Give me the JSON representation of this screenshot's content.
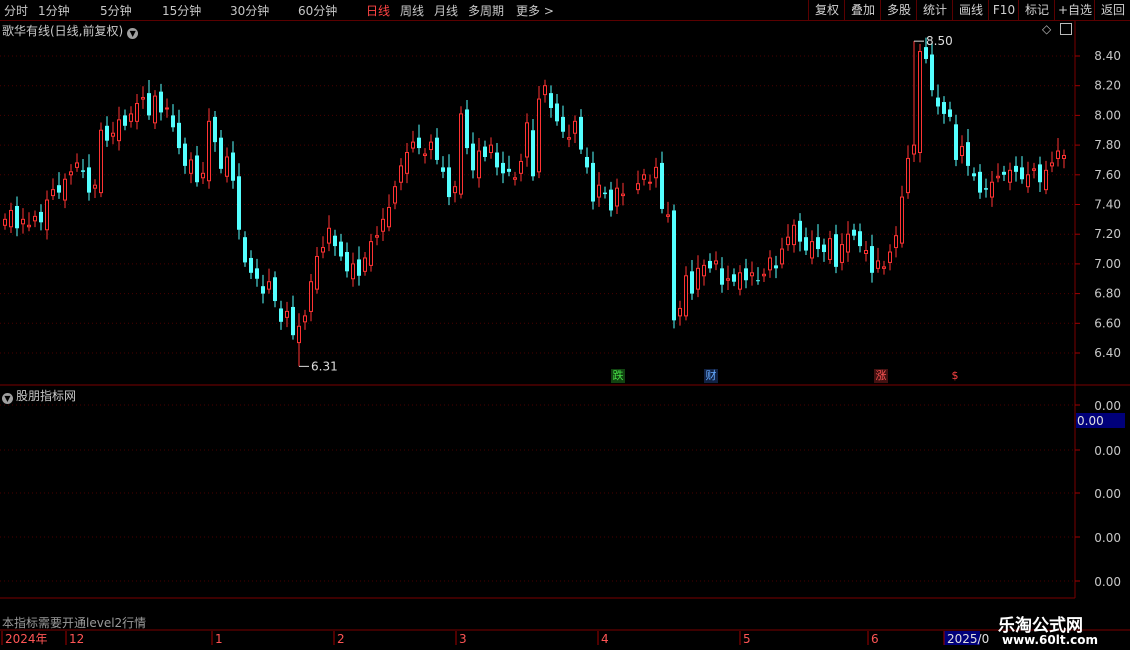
{
  "timeframes": [
    {
      "label": "分时",
      "active": false
    },
    {
      "label": "1分钟",
      "active": false
    },
    {
      "label": "5分钟",
      "active": false
    },
    {
      "label": "15分钟",
      "active": false
    },
    {
      "label": "30分钟",
      "active": false
    },
    {
      "label": "60分钟",
      "active": false
    },
    {
      "label": "日线",
      "active": true
    },
    {
      "label": "周线",
      "active": false
    },
    {
      "label": "月线",
      "active": false
    },
    {
      "label": "多周期",
      "active": false
    },
    {
      "label": "更多 >",
      "active": false
    }
  ],
  "right_buttons": [
    "复权",
    "叠加",
    "多股",
    "统计",
    "画线",
    "F10",
    "标记",
    "+自选",
    "返回"
  ],
  "main_title": "歌华有线(日线,前复权)",
  "indicator_title": "股朋指标网",
  "indicator_note": "本指标需要开通level2行情",
  "watermark": {
    "name": "乐淘公式网",
    "url": "www.60lt.com"
  },
  "colors": {
    "up": "#ff3333",
    "down": "#54ffff",
    "grid": "#4a0000",
    "axis_text": "#c8c8c8",
    "highlight_bg": "#00007a"
  },
  "info_markers": [
    {
      "label": "跌",
      "color": "#44dd44",
      "after_bar": "2024-04 gap"
    },
    {
      "label": "财",
      "color": "#66aaff",
      "after_bar": "May"
    },
    {
      "label": "涨",
      "color": "#ff4444",
      "after_bar": "June"
    },
    {
      "label": "$",
      "color": "#ff4444",
      "after_bar": "June"
    }
  ],
  "chart_data": [
    {
      "type": "candlestick",
      "title": "歌华有线(日线,前复权)",
      "ylim": [
        6.3,
        8.55
      ],
      "yticks": [
        6.4,
        6.6,
        6.8,
        7.0,
        7.2,
        7.4,
        7.6,
        7.8,
        8.0,
        8.2,
        8.4
      ],
      "ytick_labels": [
        "6.40",
        "6.60",
        "6.80",
        "7.00",
        "7.20",
        "7.40",
        "7.60",
        "7.80",
        "8.00",
        "8.20",
        "8.40"
      ],
      "high_annotation": {
        "value": 8.5,
        "label": "8.50"
      },
      "low_annotation": {
        "value": 6.31,
        "label": "6.31"
      },
      "x_labels": [
        "2024年",
        "12",
        "1",
        "2",
        "3",
        "4",
        "5",
        "6",
        "2025/0"
      ],
      "closes": [
        7.3,
        7.36,
        7.24,
        7.3,
        7.26,
        7.32,
        7.28,
        7.43,
        7.5,
        7.48,
        7.57,
        7.62,
        7.68,
        7.62,
        7.48,
        7.53,
        7.9,
        7.83,
        7.88,
        7.97,
        7.93,
        8.01,
        8.08,
        8.12,
        8.0,
        8.13,
        8.02,
        8.05,
        7.92,
        7.78,
        7.66,
        7.7,
        7.55,
        7.61,
        7.96,
        7.82,
        7.64,
        7.72,
        7.56,
        7.23,
        7.01,
        6.94,
        6.9,
        6.8,
        6.88,
        6.75,
        6.61,
        6.68,
        6.52,
        6.58,
        6.65,
        6.88,
        7.05,
        7.11,
        7.24,
        7.12,
        7.05,
        6.95,
        7.0,
        6.92,
        7.04,
        7.15,
        7.19,
        7.3,
        7.38,
        7.52,
        7.66,
        7.75,
        7.82,
        7.78,
        7.74,
        7.82,
        7.7,
        7.62,
        7.45,
        7.52,
        8.01,
        7.78,
        7.63,
        7.76,
        7.72,
        7.8,
        7.65,
        7.61,
        7.62,
        7.58,
        7.69,
        7.95,
        7.59,
        8.11,
        8.2,
        8.05,
        7.96,
        7.89,
        7.85,
        7.96,
        7.77,
        7.65,
        7.42,
        7.53,
        7.47,
        7.36,
        7.51,
        7.47,
        7.54,
        7.6,
        7.55,
        7.65,
        7.37,
        7.33,
        6.62,
        6.7,
        6.92,
        6.8,
        6.97,
        6.99,
        6.97,
        7.02,
        6.86,
        6.9,
        6.88,
        6.94,
        6.89,
        6.94,
        6.89,
        6.93,
        7.04,
        6.97,
        7.1,
        7.18,
        7.26,
        7.15,
        7.09,
        7.15,
        7.1,
        7.08,
        7.17,
        6.98,
        7.13,
        7.2,
        7.19,
        7.12,
        7.09,
        6.94,
        7.02,
        6.98,
        7.08,
        7.19,
        7.45,
        7.71,
        7.8,
        8.43,
        8.38,
        8.17,
        8.06,
        8.01,
        7.99,
        7.7,
        7.79,
        7.66,
        7.59,
        7.48,
        7.5,
        7.55,
        7.59,
        7.6,
        7.63,
        7.62,
        7.57,
        7.6,
        7.64,
        7.55,
        7.63,
        7.68,
        7.76,
        7.73
      ]
    },
    {
      "type": "line",
      "title": "股朋指标网",
      "yticks": [
        "0.00",
        "0.00",
        "0.00",
        "0.00",
        "0.00"
      ],
      "current_value": "0.00"
    }
  ]
}
